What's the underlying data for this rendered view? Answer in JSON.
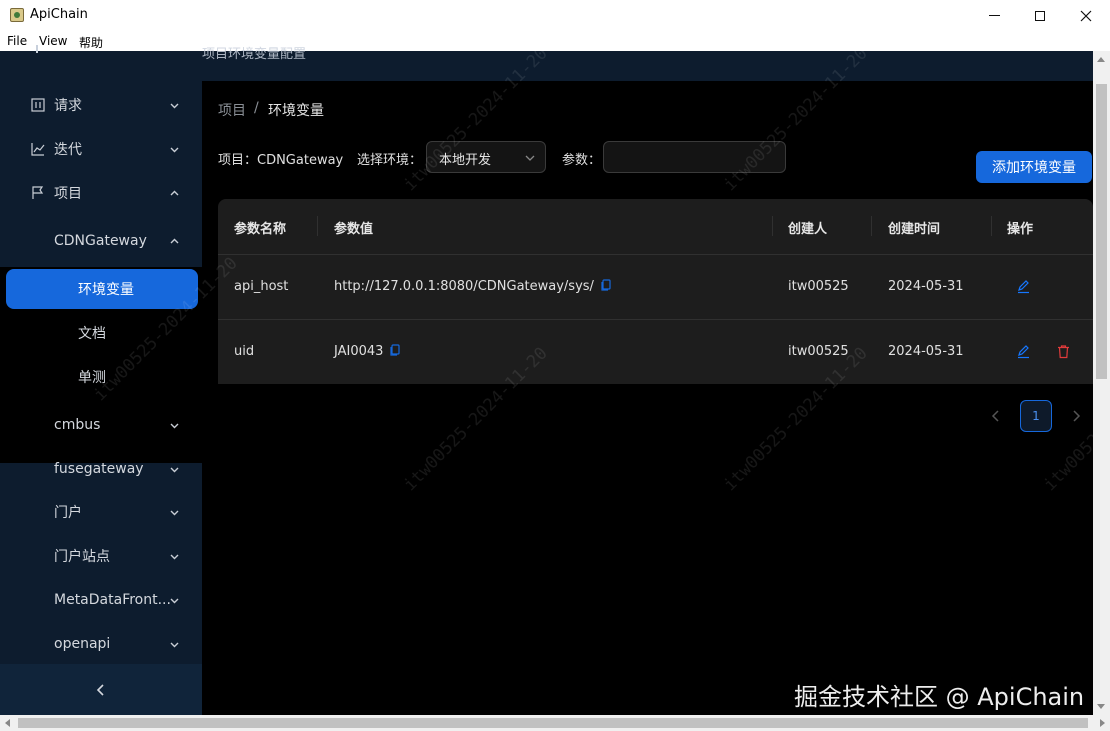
{
  "window": {
    "title": "ApiChain",
    "menu": [
      "File",
      "View",
      "帮助"
    ]
  },
  "header": {
    "title": "项目环境变量配置"
  },
  "sidebar": {
    "items": [
      {
        "label": "请求",
        "icon": "chart-icon"
      },
      {
        "label": "迭代",
        "icon": "line-chart-icon"
      },
      {
        "label": "项目",
        "icon": "flag-icon"
      },
      {
        "label": "CDNGateway"
      },
      {
        "label": "环境变量"
      },
      {
        "label": "文档"
      },
      {
        "label": "单测"
      },
      {
        "label": "cmbus"
      },
      {
        "label": "fusegateway"
      },
      {
        "label": "门户"
      },
      {
        "label": "门户站点"
      },
      {
        "label": "MetaDataFront..."
      },
      {
        "label": "openapi"
      }
    ]
  },
  "breadcrumb": {
    "root": "项目",
    "separator": "/",
    "current": "环境变量"
  },
  "filters": {
    "project_label": "项目：CDNGateway",
    "env_label": "选择环境：",
    "env_value": "本地开发",
    "param_label": "参数：",
    "param_value": ""
  },
  "actions": {
    "add_label": "添加环境变量"
  },
  "table": {
    "columns": [
      "参数名称",
      "参数值",
      "创建人",
      "创建时间",
      "操作"
    ],
    "rows": [
      {
        "name": "api_host",
        "value": "http://127.0.0.1:8080/CDNGateway/sys/",
        "creator": "itw00525",
        "created": "2024-05-31"
      },
      {
        "name": "uid",
        "value": "JAI0043",
        "creator": "itw00525",
        "created": "2024-05-31"
      }
    ]
  },
  "pagination": {
    "current": "1"
  },
  "watermark": "itw00525-2024-11-20",
  "credit": "掘金技术社区 @ ApiChain",
  "colors": {
    "accent": "#1668dc",
    "sidebar": "#0d1c2e",
    "danger": "#e23b3b"
  }
}
